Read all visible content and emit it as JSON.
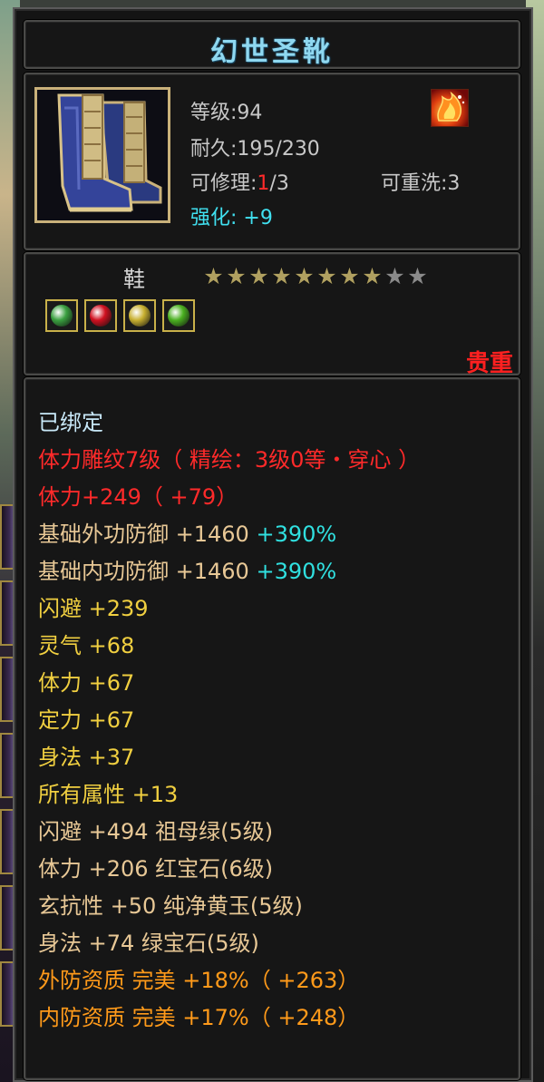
{
  "item": {
    "name": "幻世圣靴",
    "level": "等级:94",
    "durability": "耐久:195/230",
    "repair_prefix": "可修理:",
    "repair_used": "1",
    "repair_total": "/3",
    "rewash": "可重洗:3",
    "enhance_label": "强化:",
    "enhance_value": "+9",
    "type": "鞋",
    "stars_total": 10,
    "stars_filled": 8,
    "rarity": "贵重",
    "icon": "blue-boots-icon",
    "badge_icon": "flame-badge-icon",
    "gems": [
      {
        "icon": "green-jade-gem-icon",
        "color": "#3aa040"
      },
      {
        "icon": "ruby-gem-icon",
        "color": "#d01020"
      },
      {
        "icon": "yellow-topaz-gem-icon",
        "color": "#c8b030"
      },
      {
        "icon": "emerald-gem-icon",
        "color": "#4ab020"
      }
    ]
  },
  "attributes": {
    "bound": "已绑定",
    "engrave": "体力雕纹7级（ 精绘：3级0等・穿心 ）",
    "engrave_stat": "体力+249（ +79）",
    "outer_def_label": "基础外功防御 +1460 ",
    "outer_def_pct": "+390%",
    "inner_def_label": "基础内功防御 +1460 ",
    "inner_def_pct": "+390%",
    "dodge": "闪避 +239",
    "spirit": "灵气 +68",
    "stamina": "体力 +67",
    "focus": "定力 +67",
    "agility": "身法 +37",
    "all_attr": "所有属性 +13",
    "gem1": "闪避 +494 祖母绿(5级)",
    "gem2": "体力 +206 红宝石(6级)",
    "gem3": "玄抗性 +50 纯净黄玉(5级)",
    "gem4": "身法 +74 绿宝石(5级)",
    "quality1": "外防资质  完美 +18%（ +263）",
    "quality2": "内防资质  完美 +17%（ +248）"
  },
  "colors": {
    "title": "#8fd8f0",
    "rarity_red": "#ff2020",
    "enhance_cyan": "#40e0f0",
    "yellow_stat": "#f0cf40",
    "orange_quality": "#ff9a1a"
  }
}
